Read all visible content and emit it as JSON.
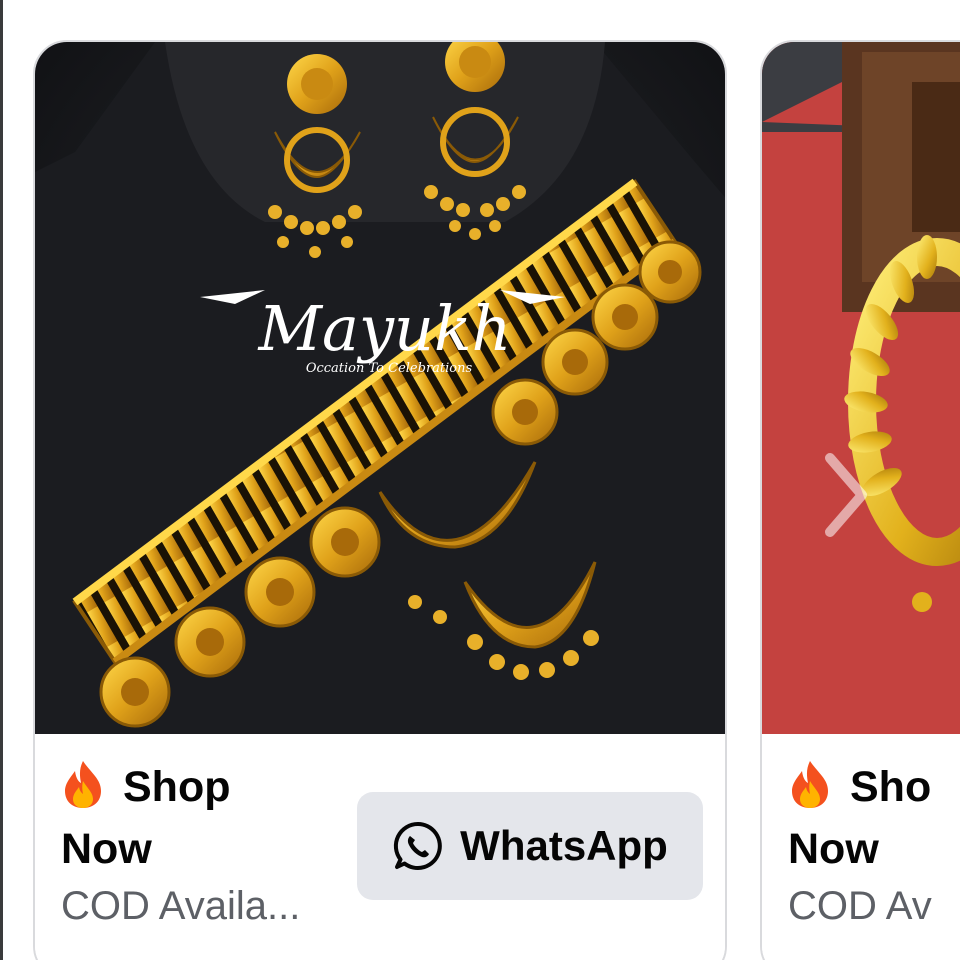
{
  "cards": [
    {
      "headline_line1": "Shop",
      "headline_line2": "Now",
      "subtitle": "COD Availa...",
      "button_label": "WhatsApp",
      "button_icon": "whatsapp-icon",
      "headline_icon": "fire-emoji-icon",
      "image_watermark": "Mayukh",
      "image_watermark_tagline": "Occation To Celebrations",
      "image_subject": "gold choker necklace and earrings"
    },
    {
      "headline_line1": "Sho",
      "headline_line2": "Now",
      "subtitle": "COD Av",
      "headline_icon": "fire-emoji-icon",
      "image_subject": "gold leaf jewelry on red cloth"
    }
  ],
  "carousel": {
    "next_icon": "chevron-right-icon"
  },
  "colors": {
    "button_bg": "#e4e6eb",
    "text_primary": "#050505",
    "text_secondary": "#5d6066",
    "card_border": "#d9dadd",
    "gold": "#e0a21a"
  }
}
